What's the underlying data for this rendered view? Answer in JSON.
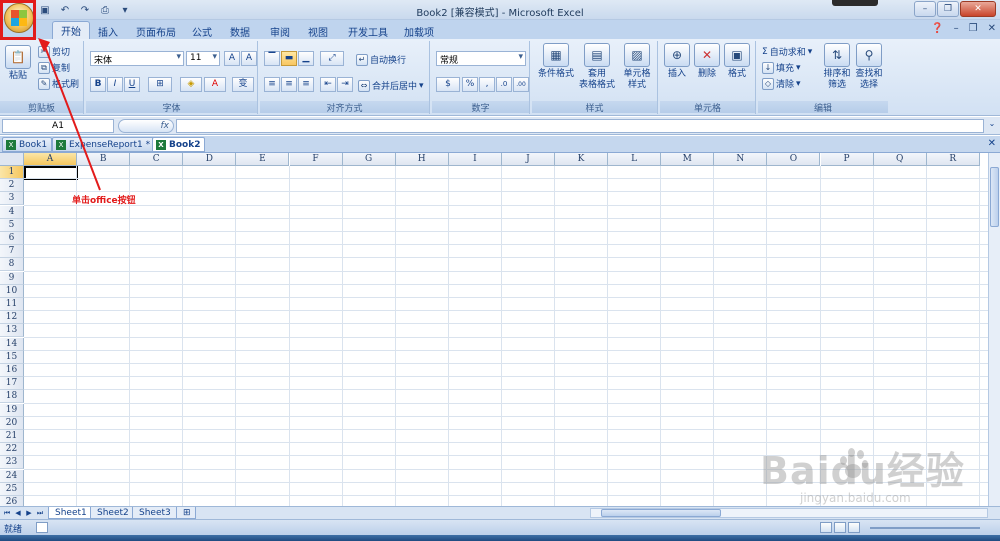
{
  "title_bar": {
    "title": "Book2  [兼容模式] - Microsoft Excel",
    "qat_icons": [
      "save-icon",
      "undo-icon",
      "redo-icon",
      "print-preview-icon",
      "customize-icon"
    ]
  },
  "ribbon_tabs": [
    "开始",
    "插入",
    "页面布局",
    "公式",
    "数据",
    "审阅",
    "视图",
    "开发工具",
    "加载项"
  ],
  "clipboard": {
    "paste": "粘贴",
    "cut": "剪切",
    "copy": "复制",
    "format_painter": "格式刷",
    "label": "剪贴板"
  },
  "font": {
    "name": "宋体",
    "size": "11",
    "grow": "A",
    "shrink": "A",
    "bold": "B",
    "italic": "I",
    "underline": "U",
    "font_color": "A",
    "phonetic": "变",
    "label": "字体"
  },
  "alignment": {
    "wrap_text": "自动换行",
    "merge_center": "合并后居中",
    "label": "对齐方式"
  },
  "number": {
    "format": "常规",
    "percent": "%",
    "comma": ",",
    "inc_decimal": ".0",
    "dec_decimal": ".00",
    "label": "数字"
  },
  "styles": {
    "conditional": "条件格式",
    "table_format_1": "套用",
    "table_format_2": "表格格式",
    "cell_styles_1": "单元格",
    "cell_styles_2": "样式",
    "label": "样式"
  },
  "cells": {
    "insert": "插入",
    "delete": "删除",
    "format": "格式",
    "label": "单元格"
  },
  "editing": {
    "autosum": "自动求和",
    "fill": "填充",
    "clear": "清除",
    "sort_1": "排序和",
    "sort_2": "筛选",
    "find_1": "查找和",
    "find_2": "选择",
    "label": "编辑"
  },
  "formula_bar": {
    "name_box": "A1",
    "fx": "fx"
  },
  "workbooks": [
    "Book1",
    "ExpenseReport1 *",
    "Book2"
  ],
  "columns": [
    "A",
    "B",
    "C",
    "D",
    "E",
    "F",
    "G",
    "H",
    "I",
    "J",
    "K",
    "L",
    "M",
    "N",
    "O",
    "P",
    "Q",
    "R"
  ],
  "rows": [
    "1",
    "2",
    "3",
    "4",
    "5",
    "6",
    "7",
    "8",
    "9",
    "10",
    "11",
    "12",
    "13",
    "14",
    "15",
    "16",
    "17",
    "18",
    "19",
    "20",
    "21",
    "22",
    "23",
    "24",
    "25",
    "26"
  ],
  "annotation": "单击office按钮",
  "sheets": [
    "Sheet1",
    "Sheet2",
    "Sheet3"
  ],
  "status": "就绪",
  "watermark": {
    "main": "Baidu经验",
    "sub": "jingyan.baidu.com"
  },
  "colors": {
    "annotation_red": "#e21b1b",
    "ribbon_blue": "#d2e1f3",
    "text_blue": "#15428b"
  }
}
